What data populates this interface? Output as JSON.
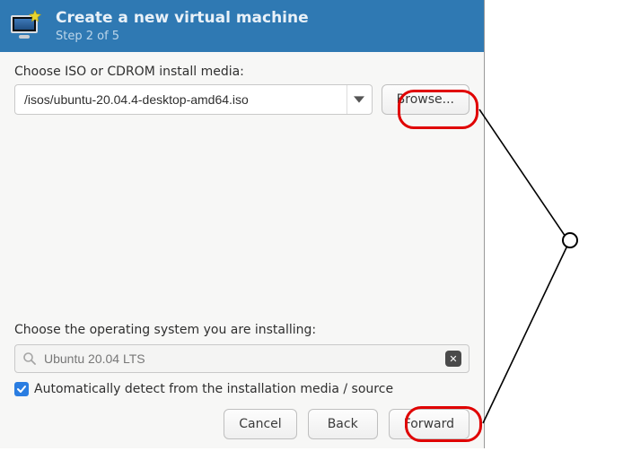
{
  "header": {
    "title": "Create a new virtual machine",
    "subtitle": "Step 2 of 5"
  },
  "media": {
    "label": "Choose ISO or CDROM install media:",
    "path": "/isos/ubuntu-20.04.4-desktop-amd64.iso",
    "browse_label": "Browse..."
  },
  "os": {
    "label": "Choose the operating system you are installing:",
    "search_value": "Ubuntu 20.04 LTS",
    "autodetect_checked": true,
    "autodetect_label": "Automatically detect from the installation media / source"
  },
  "buttons": {
    "cancel": "Cancel",
    "back": "Back",
    "forward": "Forward"
  }
}
